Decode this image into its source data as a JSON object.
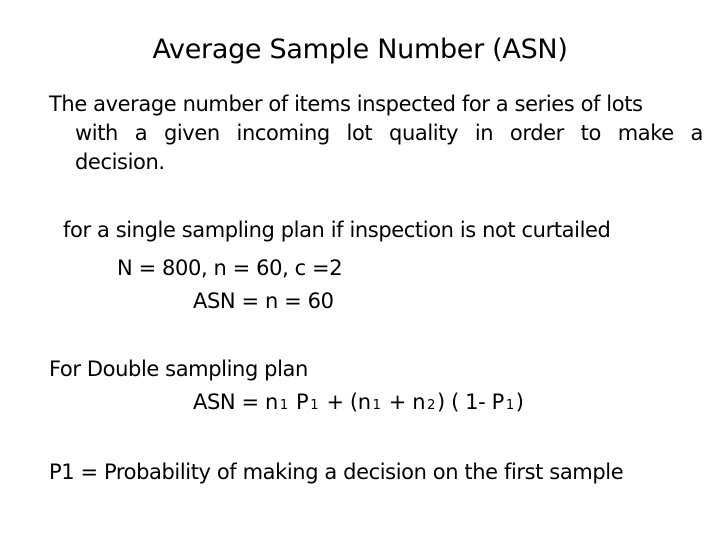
{
  "slide": {
    "title": "Average Sample Number (ASN)",
    "definition": {
      "line1": "The average number of items inspected for a series of lots",
      "line2_words": [
        "with",
        "a",
        "given",
        "incoming",
        "lot",
        "quality",
        "in",
        "order",
        "to",
        "make",
        "a"
      ],
      "line3": "decision."
    },
    "single_sampling": {
      "intro": "for a single sampling plan if inspection is not curtailed",
      "params": "N = 800, n = 60, c =2",
      "asn": "ASN = n = 60"
    },
    "double_sampling": {
      "intro": "For Double sampling plan",
      "formula": {
        "lhs": "ASN = n",
        "sub_n1_a": "1",
        "p1_a": " P",
        "sub_p1_a": "1",
        "plus_open": " + (n",
        "sub_n1_b": "1",
        "plus_n2": " + n",
        "sub_n2": "2",
        "close_open": ") ( 1- P",
        "sub_p1_b": "1",
        "close": ")"
      }
    },
    "p1_definition": "P1 = Probability of making a decision on the first sample"
  }
}
